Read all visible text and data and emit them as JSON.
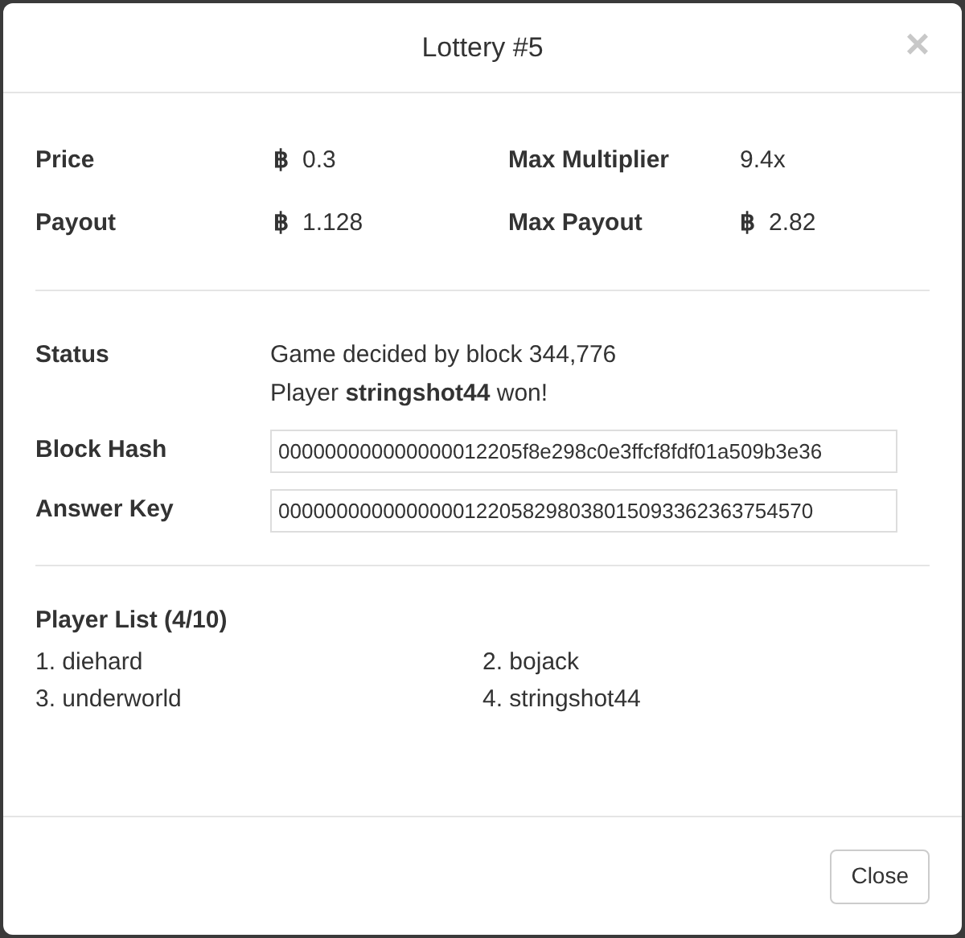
{
  "dialog": {
    "title": "Lottery #5",
    "close_icon": "×"
  },
  "stats": [
    {
      "label": "Price",
      "currency": "฿",
      "value": "0.3"
    },
    {
      "label": "Max Multiplier",
      "value": "9.4x"
    },
    {
      "label": "Payout",
      "currency": "฿",
      "value": "1.128"
    },
    {
      "label": "Max Payout",
      "currency": "฿",
      "value": "2.82"
    }
  ],
  "status": {
    "label": "Status",
    "lines": [
      "Game decided by block 344,776",
      "Player **stringshot44** won!"
    ]
  },
  "fields": [
    {
      "label": "Block Hash",
      "value": "000000000000000012205f8e298c0e3ffcf8fdf01a509b3e36"
    },
    {
      "label": "Answer Key",
      "value": "000000000000000012205829803801509336236375457​0"
    }
  ],
  "players": {
    "title": "Player List (4/10)",
    "items": [
      "1. diehard",
      "2. bojack",
      "3. underworld",
      "4. stringshot44"
    ]
  },
  "footer": {
    "button": "Close"
  }
}
